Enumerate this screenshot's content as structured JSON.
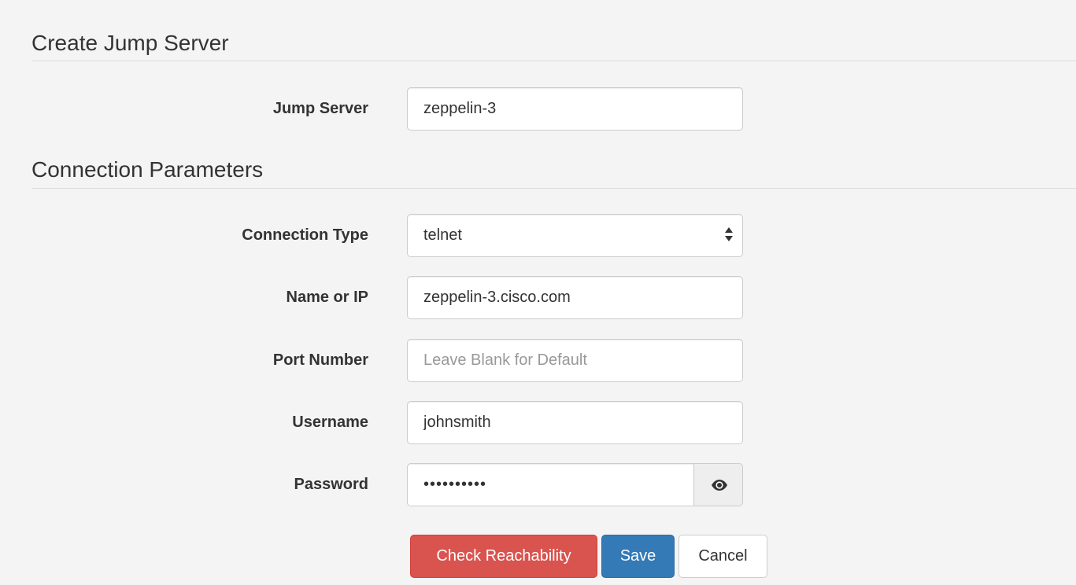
{
  "sections": {
    "create_title": "Create Jump Server",
    "connection_title": "Connection Parameters"
  },
  "fields": {
    "jump_server": {
      "label": "Jump Server",
      "value": "zeppelin-3"
    },
    "connection_type": {
      "label": "Connection Type",
      "value": "telnet"
    },
    "name_or_ip": {
      "label": "Name or IP",
      "value": "zeppelin-3.cisco.com"
    },
    "port_number": {
      "label": "Port Number",
      "value": "",
      "placeholder": "Leave Blank for Default"
    },
    "username": {
      "label": "Username",
      "value": "johnsmith"
    },
    "password": {
      "label": "Password",
      "masked_value": "••••••••••",
      "toggle_icon": "eye-icon"
    }
  },
  "buttons": {
    "check_reachability": "Check Reachability",
    "save": "Save",
    "cancel": "Cancel"
  },
  "colors": {
    "danger": "#d9534f",
    "primary": "#337ab7",
    "background": "#f4f4f4"
  }
}
